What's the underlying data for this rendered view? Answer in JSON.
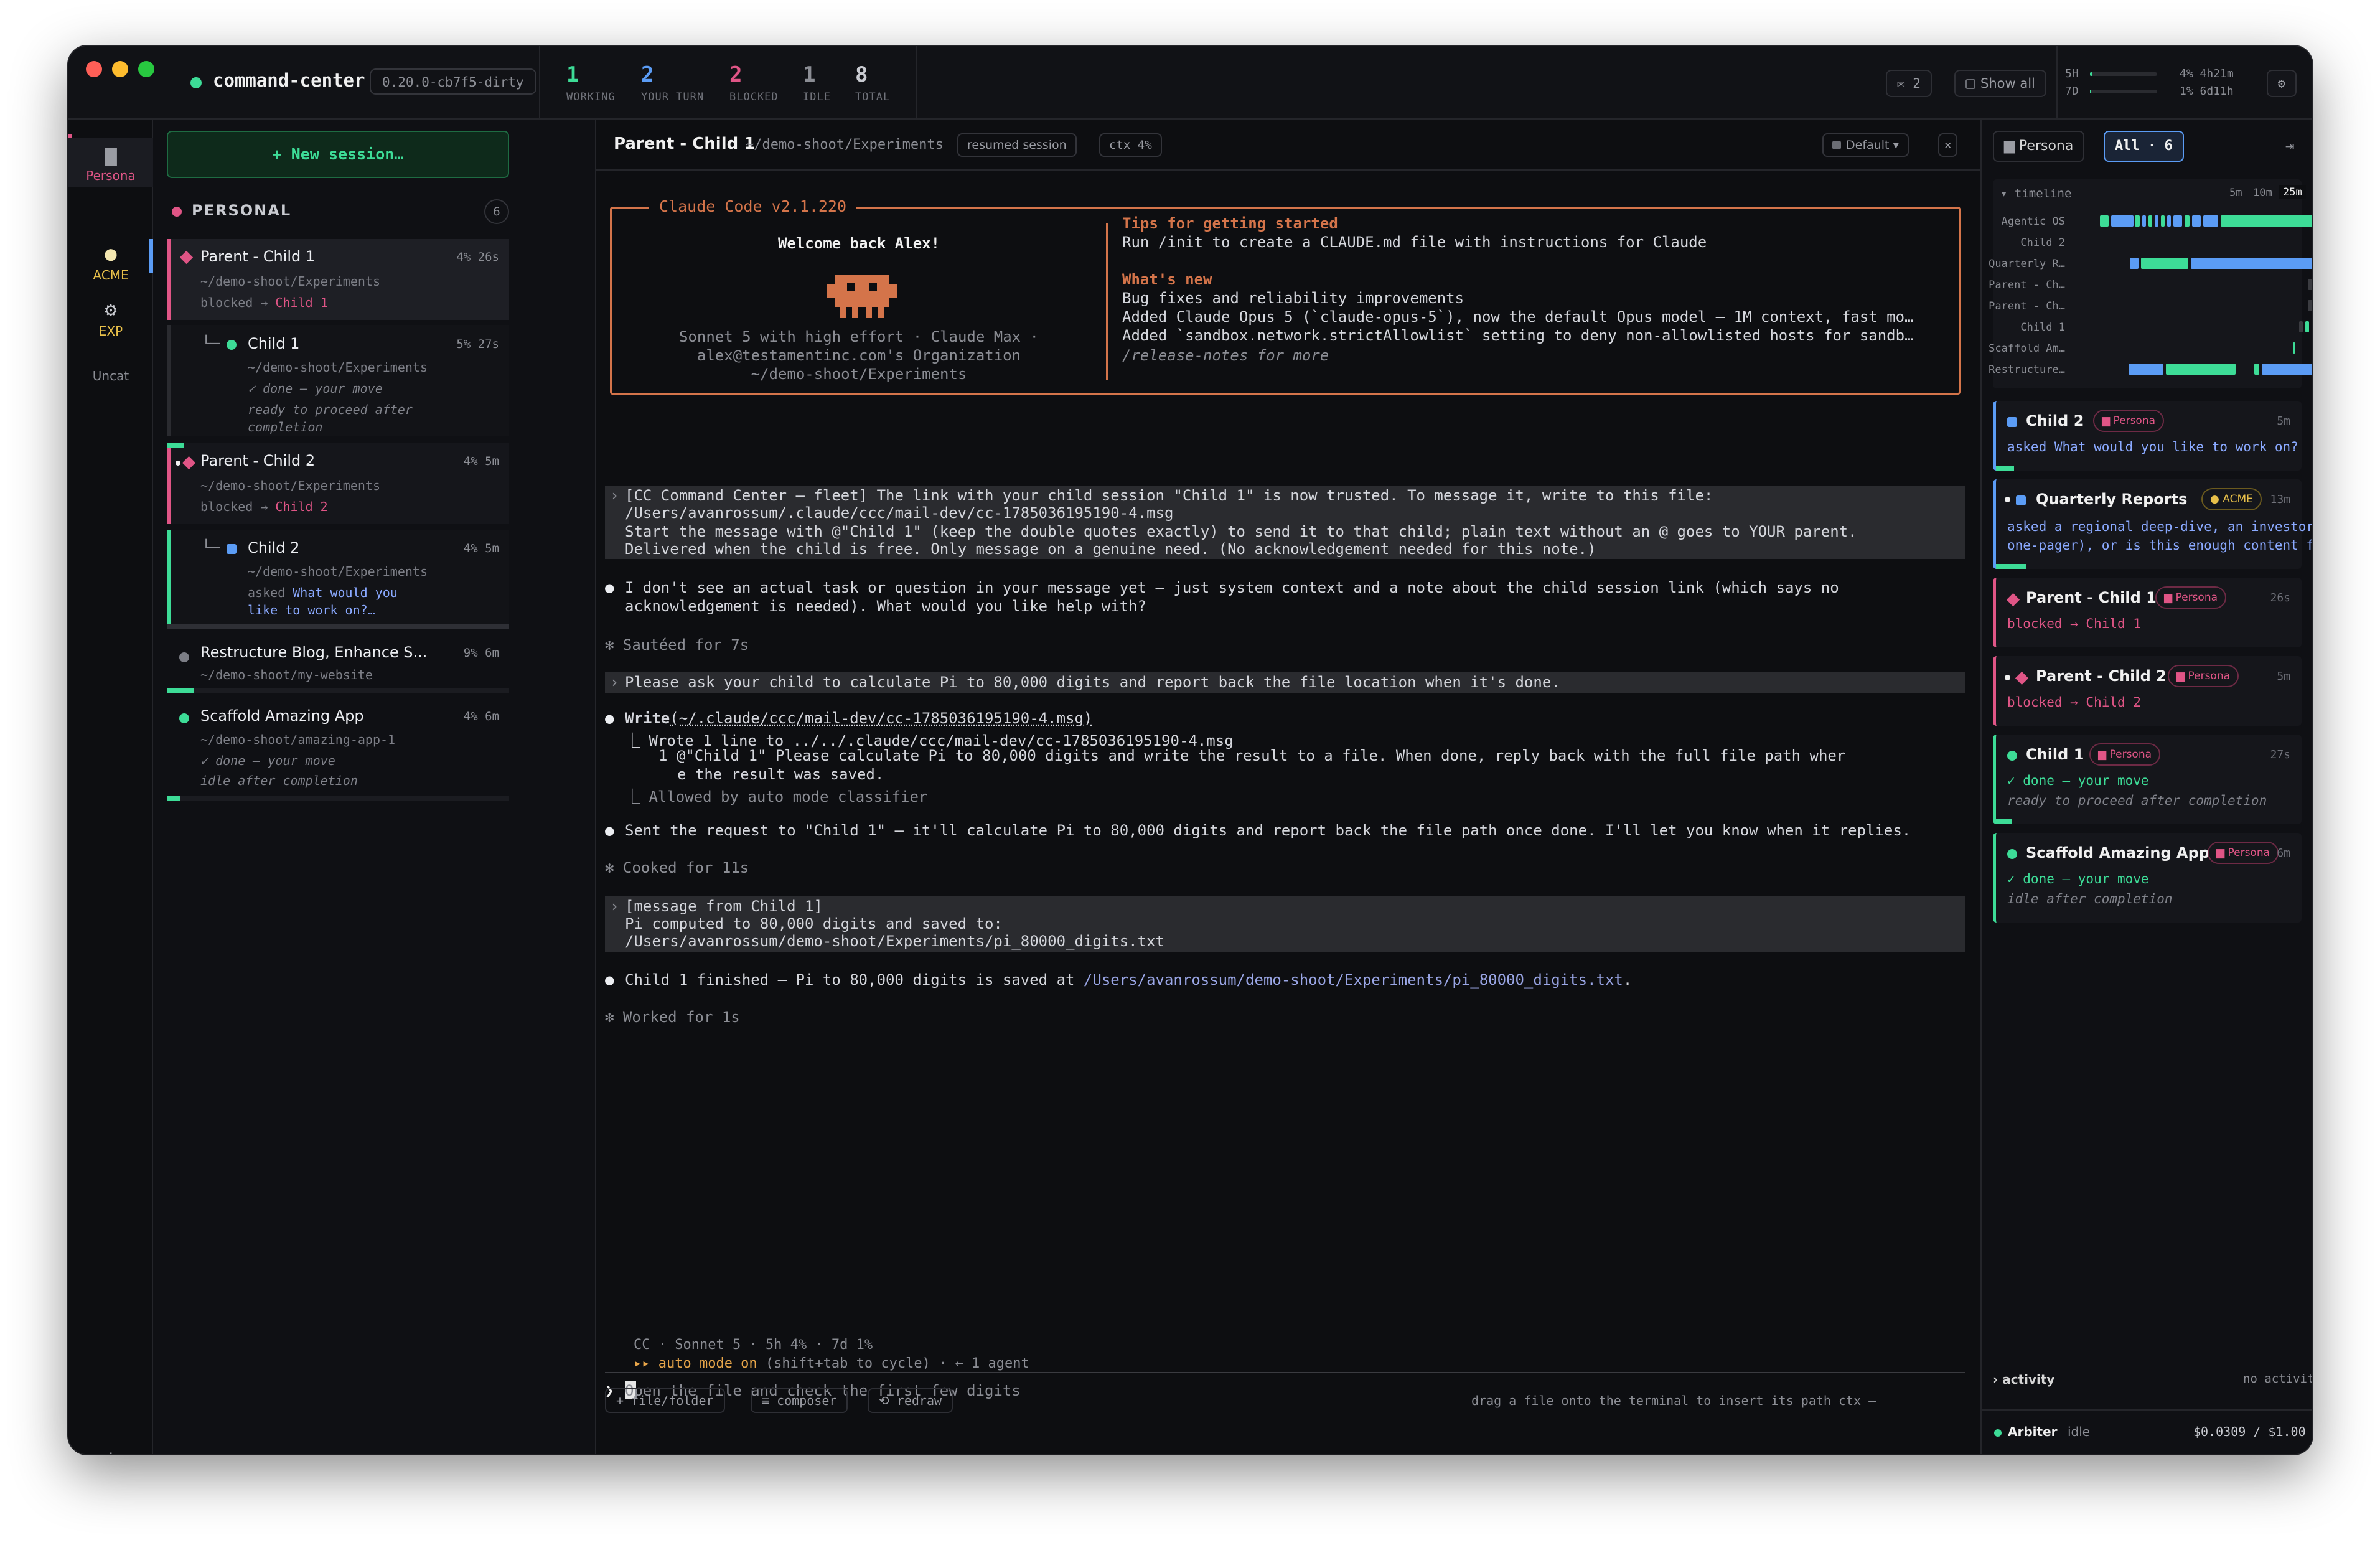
{
  "app": {
    "title": "command-center",
    "version": "0.20.0-cb7f5-dirty",
    "stats": [
      {
        "value": "1",
        "label": "WORKING",
        "color": "#3ddc97"
      },
      {
        "value": "2",
        "label": "YOUR TURN",
        "color": "#5b9cf5"
      },
      {
        "value": "2",
        "label": "BLOCKED",
        "color": "#e05586"
      },
      {
        "value": "1",
        "label": "IDLE",
        "color": "#8b8d94"
      },
      {
        "value": "8",
        "label": "TOTAL",
        "color": "#c9cbd1"
      }
    ],
    "mail_count": "✉ 2",
    "show_all": "Show all",
    "usage": {
      "h5_label": "5H",
      "h5_text": "4% 4h21m",
      "h5_pct": 4,
      "d7_label": "7D",
      "d7_text": "1% 6d11h",
      "d7_pct": 1
    },
    "settings_icon": "⚙"
  },
  "rail": [
    {
      "label": "Persona",
      "icon": "folder-icon"
    },
    {
      "label": "ACME",
      "icon": "lightbulb-icon"
    },
    {
      "label": "EXP",
      "icon": "gear-icon"
    },
    {
      "label": "Uncat",
      "icon": ""
    }
  ],
  "rail_plus": "+",
  "sessions": {
    "new_label": "+ New session…",
    "group": {
      "name": "PERSONAL",
      "count": "6"
    },
    "items": [
      {
        "title": "Parent - Child 1",
        "path": "~/demo-shoot/Experiments",
        "meta": "4% 26s",
        "status_a": "blocked → ",
        "status_b": "Child 1"
      },
      {
        "title": "Child 1",
        "path": "~/demo-shoot/Experiments",
        "meta": "5% 27s",
        "status_a": "✓ done — your move",
        "status_b": "ready to proceed after",
        "status_c": "completion"
      },
      {
        "title": "Parent - Child 2",
        "path": "~/demo-shoot/Experiments",
        "meta": "4% 5m",
        "status_a": "blocked → ",
        "status_b": "Child 2"
      },
      {
        "title": "Child 2",
        "path": "~/demo-shoot/Experiments",
        "meta": "4% 5m",
        "status_a": "asked ",
        "status_b": "What would you",
        "status_c": "like to work on?…"
      },
      {
        "title": "Restructure Blog, Enhance S...",
        "path": "~/demo-shoot/my-website",
        "meta": "9% 6m"
      },
      {
        "title": "Scaffold Amazing App",
        "path": "~/demo-shoot/amazing-app-1",
        "meta": "4% 6m",
        "status_a": "✓ done — your move",
        "status_b": "idle after completion"
      }
    ]
  },
  "main": {
    "title": "Parent - Child 1",
    "path": "~/demo-shoot/Experiments",
    "pill_resumed": "resumed session",
    "pill_ctx": "ctx 4%",
    "mode": "Default ▾",
    "close": "✕",
    "welcome": {
      "title": "Claude Code v2.1.220",
      "greeting": "Welcome back Alex!",
      "model": "Sonnet 5 with high effort · Claude Max ·",
      "org": "alex@testamentinc.com's Organization",
      "cwd": "~/demo-shoot/Experiments",
      "tips_title": "Tips for getting started",
      "tips_line": "Run /init to create a CLAUDE.md file with instructions for Claude",
      "new_title": "What's new",
      "new_1": "Bug fixes and reliability improvements",
      "new_2": "Added Claude Opus 5 (`claude-opus-5`), now the default Opus model — 1M context, fast mo…",
      "new_3": "Added `sandbox.network.strictAllowlist` setting to deny non-allowlisted hosts for sandb…",
      "new_4": "/release-notes for more"
    },
    "lines": {
      "sys1": "[CC Command Center — fleet] The link with your child session \"Child 1\" is now trusted. To message it, write to this file:",
      "sys2": "/Users/avanrossum/.claude/ccc/mail-dev/cc-1785036195190-4.msg",
      "sys3": "Start the message with @\"Child 1\" (keep the double quotes exactly) to send it to that child; plain text without an @ goes to YOUR parent.",
      "sys4": "Delivered when the child is free. Only message on a genuine need. (No acknowledgement needed for this note.)",
      "r1a": "I don't see an actual task or question in your message yet — just system context and a note about the child session link (which says no",
      "r1b": "acknowledgement is needed). What would you like help with?",
      "t1": "✻ Sautéed for 7s",
      "u1": "Please ask your child to calculate Pi to 80,000 digits and report back the file location when it's done.",
      "w_tool": "Write",
      "w_arg": "(~/.claude/ccc/mail-dev/cc-1785036195190-4.msg)",
      "w1": "⎿  Wrote 1 line to ../../.claude/ccc/mail-dev/cc-1785036195190-4.msg",
      "w2": "1 @\"Child 1\" Please calculate Pi to 80,000 digits and write the result to a file. When done, reply back with the full file path wher",
      "w3": "e the result was saved.",
      "w4": "⎿  Allowed by auto mode classifier",
      "r2": "Sent the request to \"Child 1\" — it'll calculate Pi to 80,000 digits and report back the file path once done. I'll let you know when it replies.",
      "t2": "✻ Cooked for 11s",
      "m1": "[message from Child 1]",
      "m2": "Pi computed to 80,000 digits and saved to:",
      "m3": "/Users/avanrossum/demo-shoot/Experiments/pi_80000_digits.txt",
      "r3a": "Child 1 finished — Pi to 80,000 digits is saved at ",
      "r3b": "/Users/avanrossum/demo-shoot/Experiments/pi_80000_digits.txt",
      "r3c": ".",
      "t3": "✻ Worked for 1s"
    },
    "input_placeholder": "Open the file and check the first few digits",
    "status1": "CC · Sonnet 5 · 5h 4% · 7d 1%",
    "status2a": "▸▸ auto mode on",
    "status2b": " (shift+tab to cycle) · ← 1 agent",
    "footer_btns": [
      "+ file/folder",
      "≡ composer",
      "⟲ redraw"
    ],
    "footer_hint": "drag a file onto the terminal to insert its path  ctx —"
  },
  "right": {
    "tab_persona": "Persona",
    "tab_all": "All · 6",
    "collapse": "⇥",
    "timeline": {
      "label": "▾ timeline",
      "ranges": [
        "5m",
        "10m",
        "25m"
      ],
      "rows": [
        "Agentic OS",
        "Child 2",
        "Quarterly R…",
        "Parent - Ch…",
        "Parent - Ch…",
        "Child 1",
        "Scaffold Am…",
        "Restructure…"
      ]
    },
    "cards": [
      {
        "title": "Child 2",
        "badge": "Persona",
        "time": "5m",
        "line1": "asked What would you like to work on?"
      },
      {
        "title": "Quarterly Reports",
        "badge": "ACME",
        "time": "13m",
        "line1": "asked a regional deep-dive, an investor",
        "line2": "one-pager), or is this enough content for…"
      },
      {
        "title": "Parent - Child 1",
        "badge": "Persona",
        "time": "26s",
        "line1": "blocked → Child 1"
      },
      {
        "title": "Parent - Child 2",
        "badge": "Persona",
        "time": "5m",
        "line1": "blocked → Child 2"
      },
      {
        "title": "Child 1",
        "badge": "Persona",
        "time": "27s",
        "line1": "✓ done — your move",
        "line2": "ready to proceed after completion"
      },
      {
        "title": "Scaffold Amazing App",
        "badge": "Persona",
        "time": "6m",
        "line1": "✓ done — your move",
        "line2": "idle after completion"
      }
    ],
    "activity_label": "› activity",
    "activity_state": "no activity",
    "arbiter_name": "Arbiter",
    "arbiter_state": "idle",
    "arbiter_cost": "$0.0309 / $1.00"
  },
  "colors": {
    "green": "#3ddc97",
    "pink": "#e05586",
    "blue": "#5b9cf5",
    "orange": "#d4744a"
  }
}
